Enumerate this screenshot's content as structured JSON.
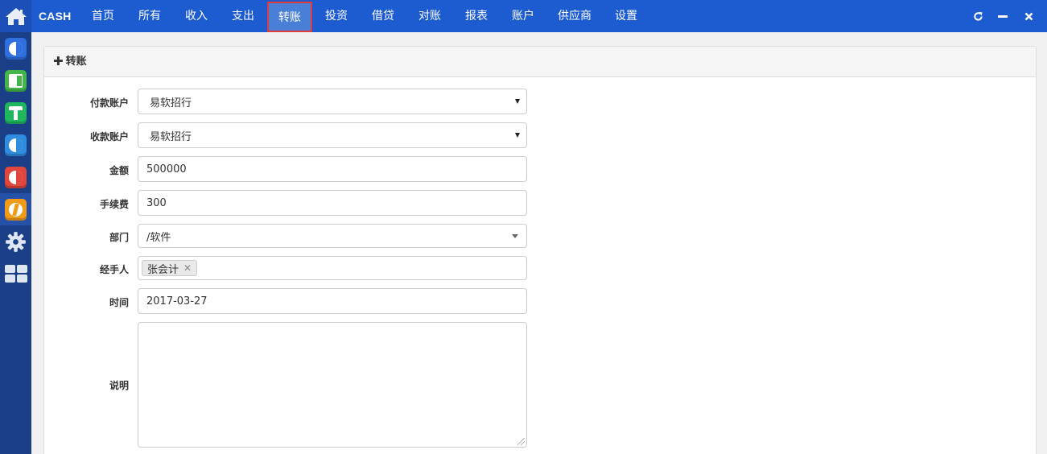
{
  "brand": "CASH",
  "nav": [
    {
      "id": "home",
      "label": "首页"
    },
    {
      "id": "all",
      "label": "所有"
    },
    {
      "id": "income",
      "label": "收入"
    },
    {
      "id": "expense",
      "label": "支出"
    },
    {
      "id": "transfer",
      "label": "转账",
      "active": true
    },
    {
      "id": "invest",
      "label": "投资"
    },
    {
      "id": "loan",
      "label": "借贷"
    },
    {
      "id": "reconcile",
      "label": "对账"
    },
    {
      "id": "report",
      "label": "报表"
    },
    {
      "id": "account",
      "label": "账户"
    },
    {
      "id": "supplier",
      "label": "供应商"
    },
    {
      "id": "settings",
      "label": "设置"
    }
  ],
  "window_controls": [
    "refresh-icon",
    "minimize-icon",
    "close-icon"
  ],
  "dock": {
    "apps": [
      {
        "icon": "crm-app-icon",
        "color": "#2f6fe0"
      },
      {
        "icon": "project-app-icon",
        "color": "#43b649"
      },
      {
        "icon": "team-app-icon",
        "color": "#1fb65e"
      },
      {
        "icon": "document-app-icon",
        "color": "#2f8de0"
      },
      {
        "icon": "chart-app-icon",
        "color": "#e0463c"
      },
      {
        "icon": "cash-app-icon",
        "color": "#f29b16"
      }
    ],
    "tools": [
      "settings-icon",
      "grid-apps-icon"
    ]
  },
  "form": {
    "title": "转账",
    "payer_account": {
      "label": "付款账户",
      "value": "易软招行"
    },
    "payee_account": {
      "label": "收款账户",
      "value": "易软招行"
    },
    "amount": {
      "label": "金额",
      "value": "500000"
    },
    "fee": {
      "label": "手续费",
      "value": "300"
    },
    "department": {
      "label": "部门",
      "value": "/软件"
    },
    "handler": {
      "label": "经手人",
      "tags": [
        "张会计"
      ]
    },
    "date": {
      "label": "时间",
      "value": "2017-03-27"
    },
    "description": {
      "label": "说明",
      "value": ""
    }
  },
  "colors": {
    "topbar": "#1c5cd0",
    "dock": "#1a3f86",
    "active_tab": "#4a7fd8",
    "active_tab_outline": "#e23b3b"
  }
}
